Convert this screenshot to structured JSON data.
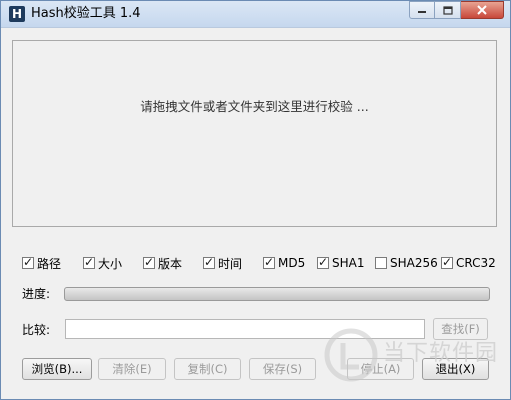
{
  "window": {
    "title": "Hash校验工具 1.4",
    "icon_letter": "H"
  },
  "drop_area": {
    "prompt": "请拖拽文件或者文件夹到这里进行校验 ..."
  },
  "options": [
    {
      "label": "路径",
      "checked": true
    },
    {
      "label": "大小",
      "checked": true
    },
    {
      "label": "版本",
      "checked": true
    },
    {
      "label": "时间",
      "checked": true
    },
    {
      "label": "MD5",
      "checked": true
    },
    {
      "label": "SHA1",
      "checked": true
    },
    {
      "label": "SHA256",
      "checked": false
    },
    {
      "label": "CRC32",
      "checked": true
    }
  ],
  "progress": {
    "label": "进度:",
    "value": 0
  },
  "compare": {
    "label": "比较:",
    "value": "",
    "find_button": "查找(F)"
  },
  "buttons": {
    "browse": "浏览(B)...",
    "clear": "清除(E)",
    "copy": "复制(C)",
    "save": "保存(S)",
    "stop": "停止(A)",
    "exit": "退出(X)"
  },
  "watermark": {
    "text": "当下软件园"
  },
  "colors": {
    "close_button": "#c8473a",
    "title_gradient": "#c5d7ee"
  }
}
